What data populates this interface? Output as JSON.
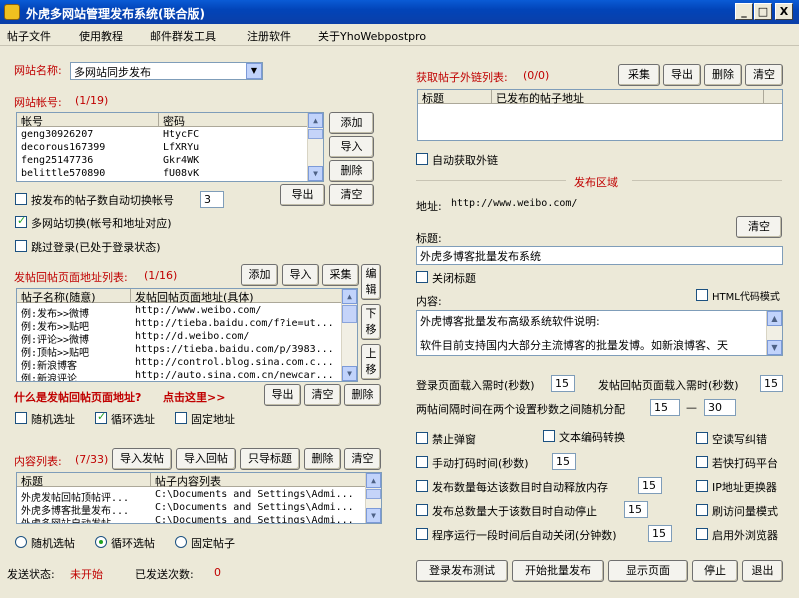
{
  "window": {
    "title": "外虎多网站管理发布系统(联合版)",
    "min": "_",
    "max": "□",
    "close": "X"
  },
  "menu": [
    "帖子文件",
    "使用教程",
    "邮件群发工具",
    "注册软件",
    "关于YhoWebpostpro"
  ],
  "site": {
    "label": "网站名称:",
    "value": "多网站同步发布"
  },
  "accounts": {
    "label": "网站帐号:",
    "count": "(1/19)",
    "col_account": "帐号",
    "col_password": "密码",
    "rows": [
      [
        "geng30926207",
        "HtycFC"
      ],
      [
        "decorous167399",
        "LfXRYu"
      ],
      [
        "feng25147736",
        "Gkr4WK"
      ],
      [
        "belittle570890",
        "fU08vK"
      ]
    ],
    "add": "添加",
    "import": "导入",
    "delete": "删除",
    "export": "导出",
    "clear": "清空",
    "auto_switch": "按发布的帖子数自动切换帐号",
    "auto_switch_count": "3",
    "multi_switch": "多网站切换(帐号和地址对应)",
    "skip_login": "跳过登录(已处于登录状态)"
  },
  "reply_pages": {
    "label": "发帖回帖页面地址列表:",
    "count": "(1/16)",
    "add": "添加",
    "import": "导入",
    "collect": "采集",
    "edit": "编辑",
    "down": "下移",
    "up": "上移",
    "col_name": "帖子名称(随意)",
    "col_url": "发帖回帖页面地址(具体)",
    "rows": [
      [
        "例:发布>>微博",
        "http://www.weibo.com/"
      ],
      [
        "例:发布>>贴吧",
        "http://tieba.baidu.com/f?ie=ut..."
      ],
      [
        "例:评论>>微博",
        "http://d.weibo.com/"
      ],
      [
        "例:顶帖>>贴吧",
        "https://tieba.baidu.com/p/3983..."
      ],
      [
        "例:新浪博客",
        "http://control.blog.sina.com.c..."
      ],
      [
        "例:新浪评论",
        "http://auto.sina.com.cn/newcar..."
      ]
    ],
    "what_link": "什么是发帖回帖页面地址?",
    "click_here": "点击这里>>",
    "export": "导出",
    "clear": "清空",
    "delete": "删除",
    "random": "随机选址",
    "loop": "循环选址",
    "fixed": "固定地址"
  },
  "content": {
    "label": "内容列表:",
    "count": "(7/33)",
    "import_post": "导入发帖",
    "import_reply": "导入回帖",
    "import_title": "只导标题",
    "delete": "删除",
    "clear": "清空",
    "col_title": "标题",
    "col_content": "帖子内容列表",
    "rows": [
      [
        "外虎发帖回帖顶帖评...",
        "C:\\Documents and Settings\\Admi..."
      ],
      [
        "外虎多博客批量发布...",
        "C:\\Documents and Settings\\Admi..."
      ],
      [
        "外虎多网站自动发帖",
        "C:\\Documents and Settings\\Admi..."
      ]
    ],
    "random": "随机选帖",
    "loop": "循环选帖",
    "fixed": "固定帖子"
  },
  "status": {
    "label": "发送状态:",
    "value": "未开始",
    "count_label": "已发送次数:",
    "count": "0"
  },
  "links": {
    "label": "获取帖子外链列表:",
    "count": "(0/0)",
    "collect": "采集",
    "export": "导出",
    "delete": "删除",
    "clear": "清空",
    "col_title": "标题",
    "col_url": "已发布的帖子地址",
    "auto": "自动获取外链"
  },
  "publish": {
    "section": "发布区域",
    "addr_label": "地址:",
    "addr": "http://www.weibo.com/",
    "clear": "清空",
    "title_label": "标题:",
    "title": "外虎多博客批量发布系统",
    "close_title": "关闭标题",
    "content_label": "内容:",
    "html_mode": "HTML代码模式",
    "content_line1": "外虎博客批量发布高级系统软件说明:",
    "content_line2": "软件目前支持国内大部分主流博客的批量发博。如新浪博客、天",
    "login_wait": "登录页面载入需时(秒数)",
    "login_wait_val": "15",
    "post_wait": "发帖回帖页面载入需时(秒数)",
    "post_wait_val": "15",
    "interval": "两帖间隔时间在两个设置秒数之间随机分配",
    "interval_min": "15",
    "interval_max": "30",
    "dash": "—",
    "block_popup": "禁止弹窗",
    "text_encode": "文本编码转换",
    "skip_err": "空读写纠错",
    "manual_time": "手动打码时间(秒数)",
    "manual_val": "15",
    "kuai": "若快打码平台",
    "release_mem": "发布数量每达该数目时自动释放内存",
    "release_val": "15",
    "ip_change": "IP地址更换器",
    "stop_total": "发布总数量大于该数目时自动停止",
    "stop_val": "15",
    "refresh": "刷访问量模式",
    "auto_close": "程序运行一段时间后自动关闭(分钟数)",
    "close_val": "15",
    "ext_browser": "启用外浏览器"
  },
  "bottom": {
    "test": "登录发布测试",
    "start": "开始批量发布",
    "show": "显示页面",
    "stop": "停止",
    "exit": "退出"
  }
}
